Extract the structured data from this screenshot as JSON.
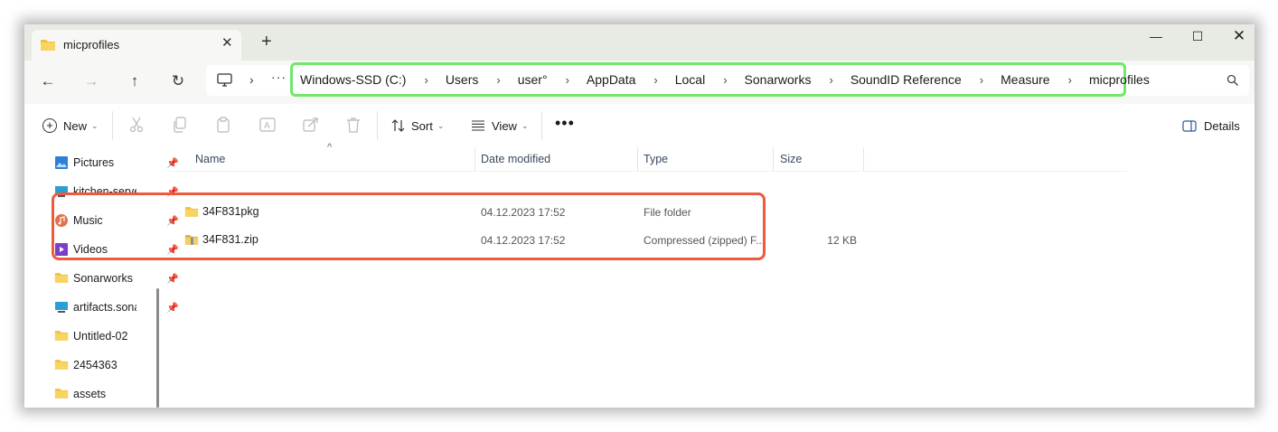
{
  "tab": {
    "title": "micprofiles",
    "close": "✕",
    "new_tab": "+"
  },
  "window_controls": {
    "minimize": "—",
    "maximize": "☐",
    "close": "✕"
  },
  "nav": {
    "back": "←",
    "forward": "→",
    "up": "↑",
    "refresh": "↻"
  },
  "address": {
    "sep": "›",
    "more": "···",
    "crumbs": [
      "Windows-SSD (C:)",
      "Users",
      "user°",
      "AppData",
      "Local",
      "Sonarworks",
      "SoundID Reference",
      "Measure",
      "micprofiles"
    ],
    "highlight_color": "#6ee86b"
  },
  "toolbar": {
    "new_label": "New",
    "sort_label": "Sort",
    "view_label": "View",
    "more_label": "•••",
    "details_label": "Details",
    "chevron": "⌄"
  },
  "sidebar": {
    "items": [
      {
        "label": "Pictures",
        "icon": "pictures-icon",
        "pinned": true
      },
      {
        "label": "kitchen-server",
        "icon": "network-drive-icon",
        "pinned": true
      },
      {
        "label": "Music",
        "icon": "music-icon",
        "pinned": true
      },
      {
        "label": "Videos",
        "icon": "videos-icon",
        "pinned": true
      },
      {
        "label": "Sonarworks",
        "icon": "folder-icon",
        "pinned": true
      },
      {
        "label": "artifacts.sonarworks",
        "icon": "network-drive-icon",
        "pinned": true
      },
      {
        "label": "Untitled-02",
        "icon": "folder-icon",
        "pinned": false
      },
      {
        "label": "2454363",
        "icon": "folder-icon",
        "pinned": false
      },
      {
        "label": "assets",
        "icon": "folder-icon",
        "pinned": false
      }
    ],
    "pin_glyph": "📌"
  },
  "columns": {
    "name": "Name",
    "date": "Date modified",
    "type": "Type",
    "size": "Size",
    "sort_caret": "^"
  },
  "files": [
    {
      "name": "34F831pkg",
      "date": "04.12.2023 17:52",
      "type": "File folder",
      "size": "",
      "icon": "folder-icon"
    },
    {
      "name": "34F831.zip",
      "date": "04.12.2023 17:52",
      "type": "Compressed (zipped) F...",
      "size": "12 KB",
      "icon": "zip-folder-icon"
    }
  ],
  "colors": {
    "file_highlight": "#ee5a3c",
    "folder_yellow": "#f3c13a",
    "titlebar": "#e8ebe4"
  }
}
